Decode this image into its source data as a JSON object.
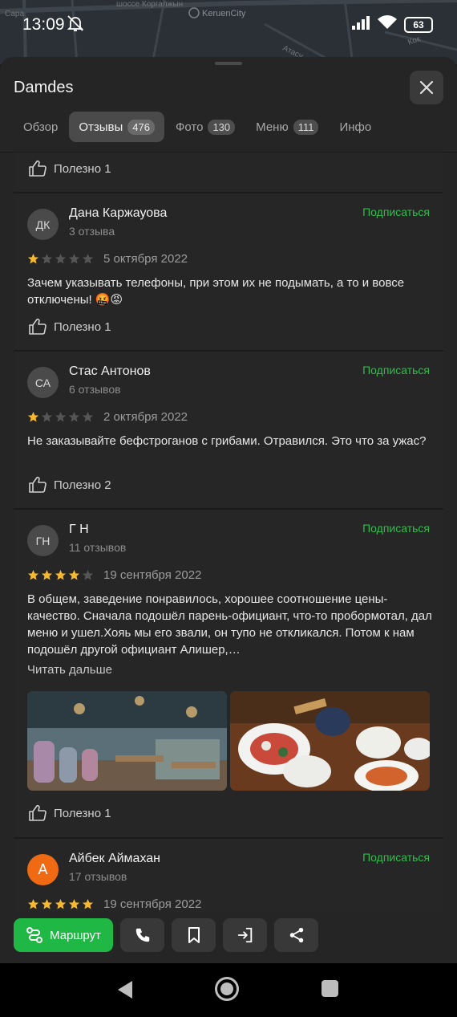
{
  "statusbar": {
    "time": "13:09",
    "battery": "63"
  },
  "map": {
    "labels": [
      "шоссе Коргалжын",
      "KeruenCity",
      "Сара",
      "Атасу",
      "Кок"
    ]
  },
  "place": {
    "title": "Damdes"
  },
  "tabs": [
    {
      "label": "Обзор",
      "count": ""
    },
    {
      "label": "Отзывы",
      "count": "476"
    },
    {
      "label": "Фото",
      "count": "130"
    },
    {
      "label": "Меню",
      "count": "111"
    },
    {
      "label": "Инфо",
      "count": ""
    }
  ],
  "prev_card": {
    "useful": "Полезно 1"
  },
  "reviews": [
    {
      "initials": "ДК",
      "name": "Дана Каржауова",
      "count": "3 отзыва",
      "subscribe": "Подписаться",
      "rating": 1,
      "date": "5 октября 2022",
      "text": "Зачем указывать телефоны, при этом их не подымать, а то и вовсе отключены! 🤬😡",
      "useful": "Полезно 1"
    },
    {
      "initials": "СА",
      "name": "Стас Антонов",
      "count": "6 отзывов",
      "subscribe": "Подписаться",
      "rating": 1,
      "date": "2 октября 2022",
      "text": "Не заказывайте бефстроганов с грибами. Отравился. Это что за ужас?",
      "useful": "Полезно 2"
    },
    {
      "initials": "ГН",
      "name": "Г Н",
      "count": "11 отзывов",
      "subscribe": "Подписаться",
      "rating": 4,
      "date": "19 сентября 2022",
      "text": "В общем, заведение понравилось, хорошее соотношение цены-качество. Сначала подошёл парень-официант, что-то пробормотал, дал меню и ушел.Хояь мы его звали, он тупо не откликался. Потом к нам подошёл другой официант Алишер,…",
      "read_more": "Читать дальше",
      "useful": "Полезно 1"
    },
    {
      "initials": "А",
      "name": "Айбек Аймахан",
      "count": "17 отзывов",
      "subscribe": "Подписаться",
      "rating": 5,
      "date": "19 сентября 2022"
    }
  ],
  "actions": {
    "route": "Маршрут"
  },
  "colors": {
    "accent_green": "#1fb844",
    "subscribe_green": "#2fbd4d",
    "star_gold": "#f5b82e",
    "star_empty": "#555555"
  }
}
